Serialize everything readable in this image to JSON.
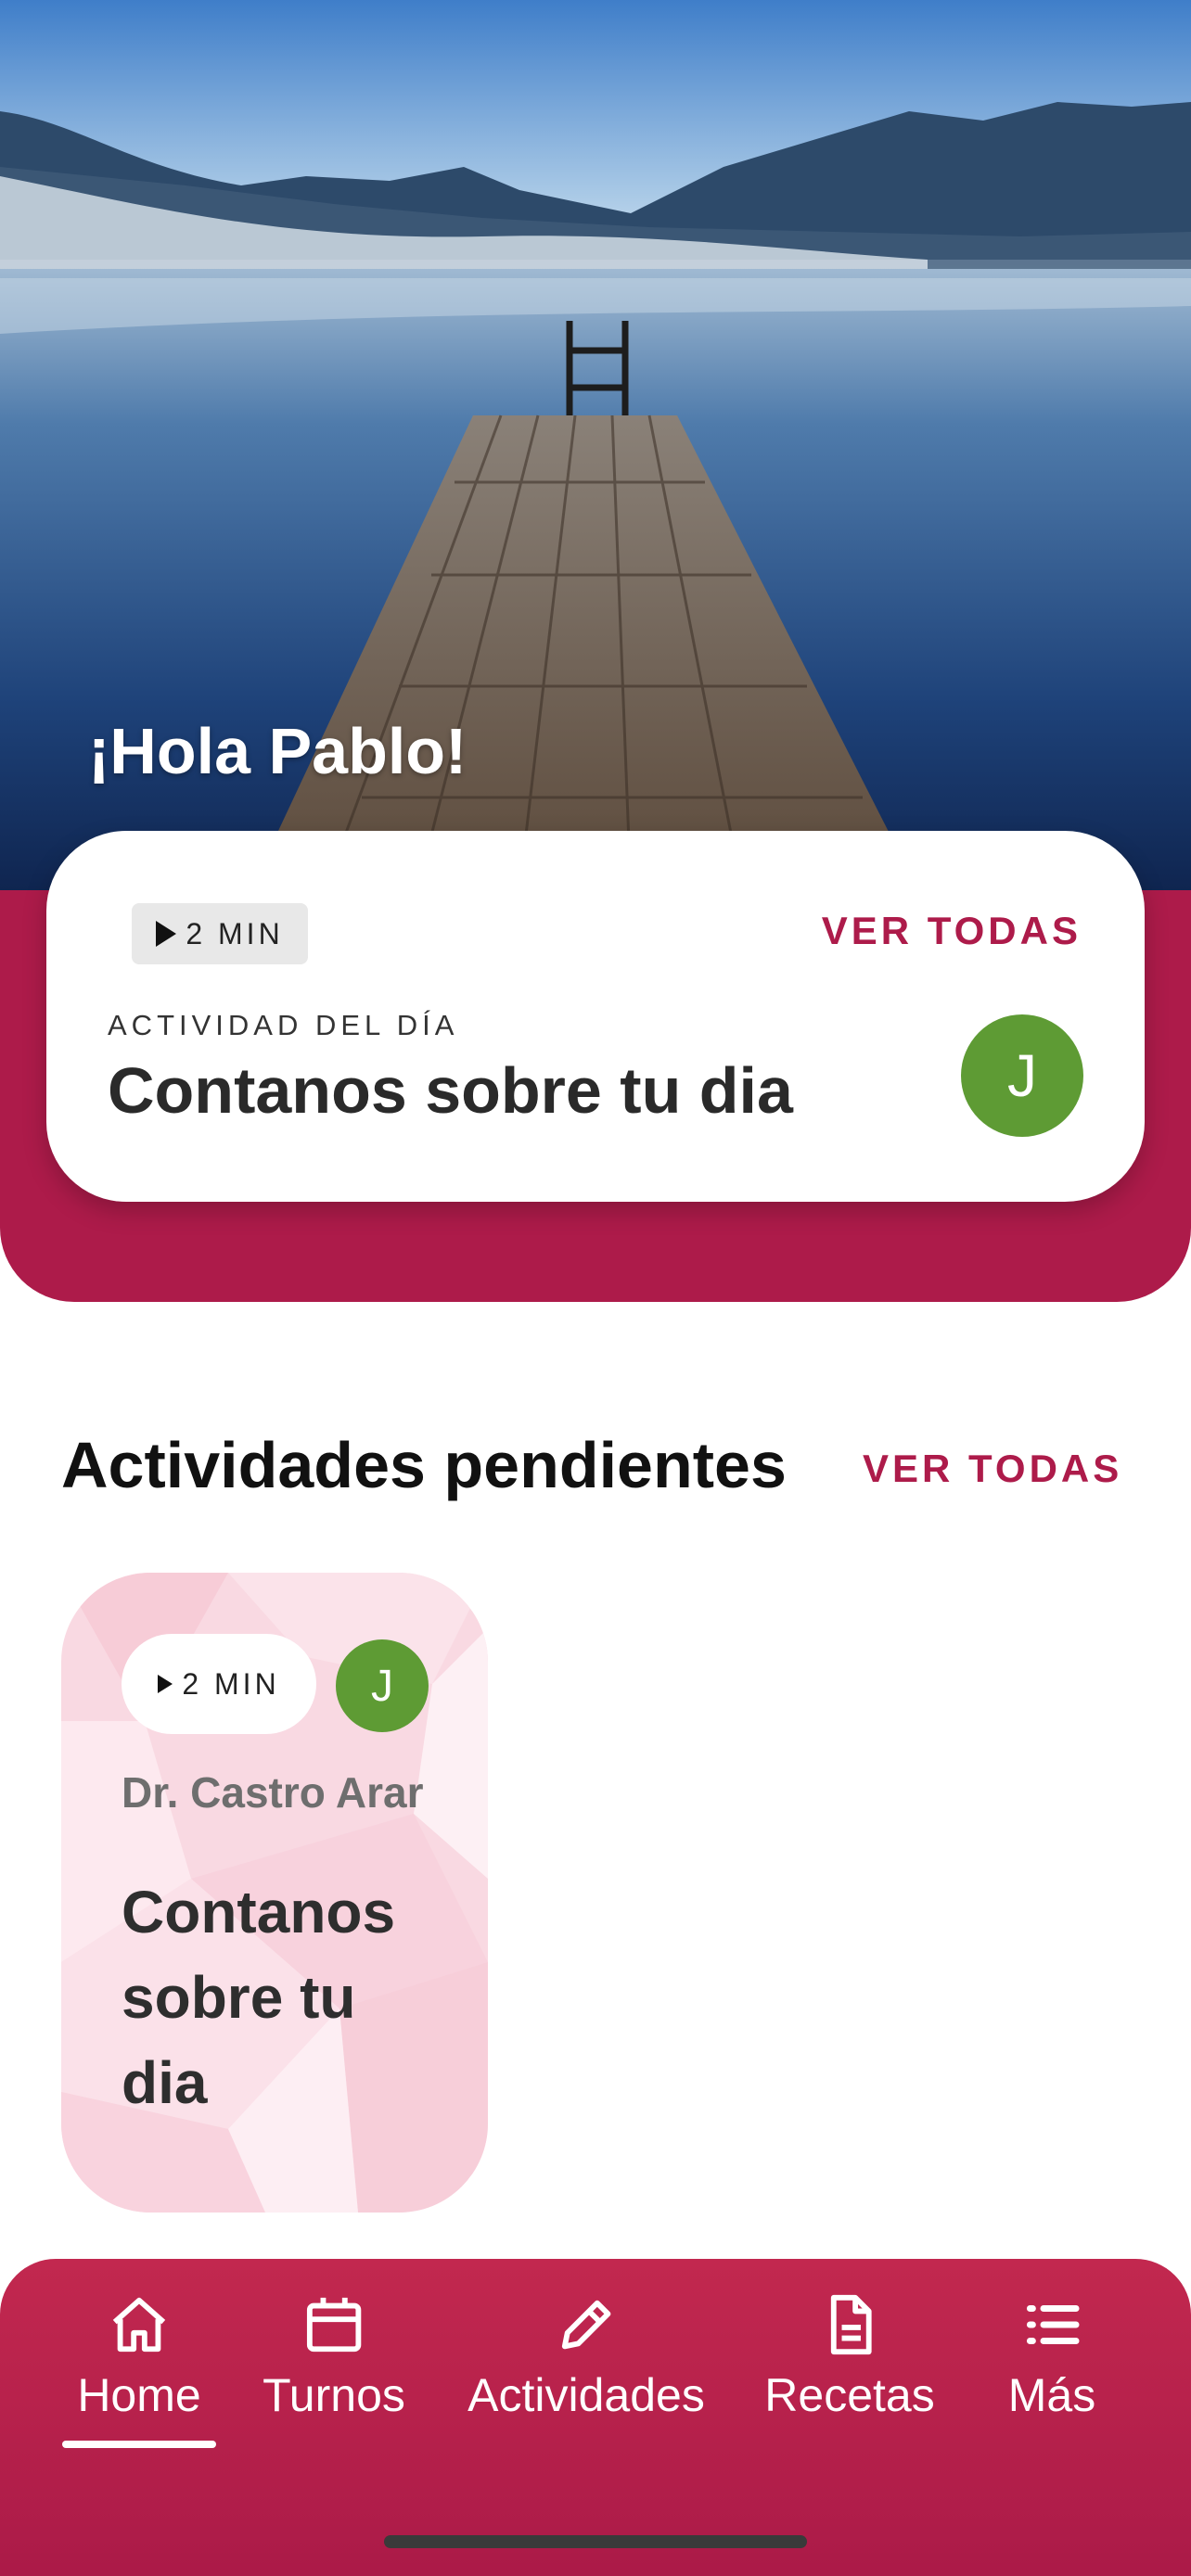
{
  "hero": {
    "greeting": "¡Hola Pablo!",
    "day_card": {
      "duration": "2 MIN",
      "ver_todas": "VER TODAS",
      "label": "ACTIVIDAD DEL DÍA",
      "title": "Contanos sobre tu dia",
      "avatar_initial": "J"
    }
  },
  "pending": {
    "title": "Actividades pendientes",
    "ver_todas": "VER TODAS",
    "card": {
      "duration": "2 MIN",
      "avatar_initial": "J",
      "doctor": "Dr. Castro Arar",
      "title": "Contanos sobre tu dia"
    }
  },
  "tabbar": {
    "tabs": [
      {
        "label": "Home",
        "icon": "home-icon",
        "active": true
      },
      {
        "label": "Turnos",
        "icon": "calendar-icon"
      },
      {
        "label": "Actividades",
        "icon": "pencil-icon"
      },
      {
        "label": "Recetas",
        "icon": "document-icon"
      },
      {
        "label": "Más",
        "icon": "list-icon"
      }
    ]
  },
  "colors": {
    "brand": "#ad1b4a",
    "avatar": "#5e9b34",
    "card_pink": "#f9d9e2"
  }
}
